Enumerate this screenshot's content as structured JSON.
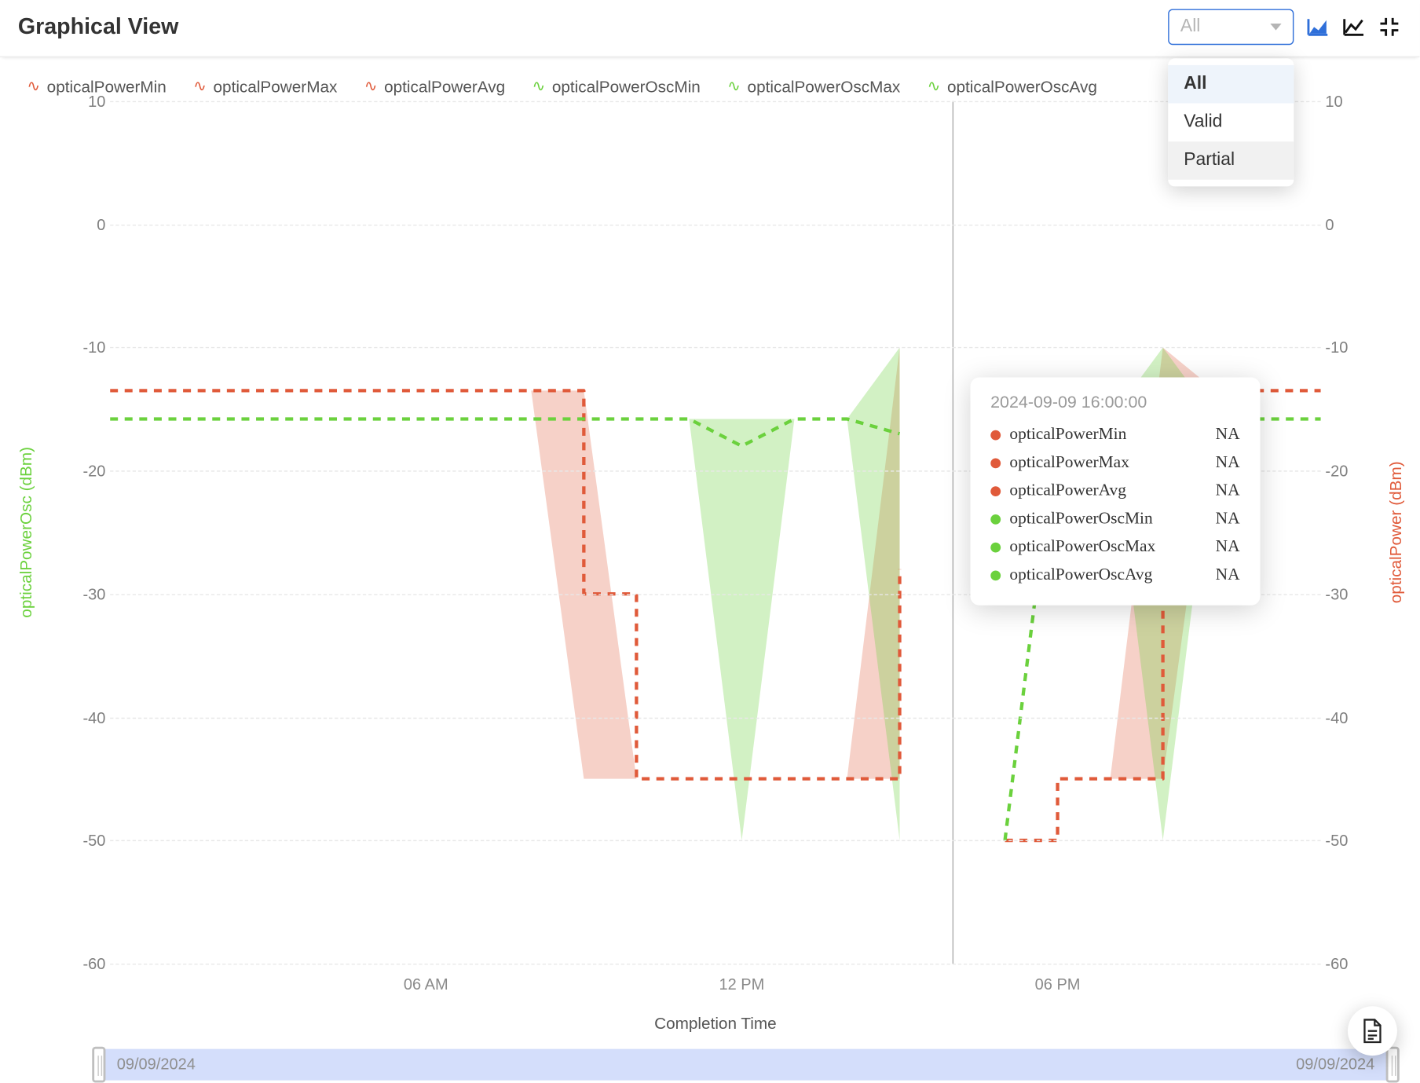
{
  "header": {
    "title": "Graphical View",
    "filter": {
      "placeholder": "All",
      "options": [
        "All",
        "Valid",
        "Partial"
      ],
      "selected": "All",
      "hovered": "Partial"
    }
  },
  "legend": [
    {
      "name": "opticalPowerMin",
      "color": "red"
    },
    {
      "name": "opticalPowerMax",
      "color": "red"
    },
    {
      "name": "opticalPowerAvg",
      "color": "red"
    },
    {
      "name": "opticalPowerOscMin",
      "color": "green"
    },
    {
      "name": "opticalPowerOscMax",
      "color": "green"
    },
    {
      "name": "opticalPowerOscAvg",
      "color": "green"
    }
  ],
  "axes": {
    "xlabel": "Completion Time",
    "xticks": [
      "06 AM",
      "12 PM",
      "06 PM"
    ],
    "yleft_label": "opticalPowerOsc (dBm)",
    "yright_label": "opticalPower (dBm)",
    "yticks_left": [
      "10",
      "0",
      "-10",
      "-20",
      "-30",
      "-40",
      "-50",
      "-60"
    ],
    "yticks_right": [
      "10",
      "0",
      "-10",
      "-20",
      "-30",
      "-40",
      "-50",
      "-60"
    ]
  },
  "tooltip": {
    "timestamp": "2024-09-09 16:00:00",
    "rows": [
      {
        "name": "opticalPowerMin",
        "color": "red",
        "value": "NA"
      },
      {
        "name": "opticalPowerMax",
        "color": "red",
        "value": "NA"
      },
      {
        "name": "opticalPowerAvg",
        "color": "red",
        "value": "NA"
      },
      {
        "name": "opticalPowerOscMin",
        "color": "green",
        "value": "NA"
      },
      {
        "name": "opticalPowerOscMax",
        "color": "green",
        "value": "NA"
      },
      {
        "name": "opticalPowerOscAvg",
        "color": "green",
        "value": "NA"
      }
    ]
  },
  "range": {
    "from": "09/09/2024",
    "to": "09/09/2024"
  },
  "colors": {
    "red": "#e05a3a",
    "green": "#6bd13d",
    "blue": "#2f6fd9"
  },
  "chart_data": {
    "type": "line",
    "x_unit": "hour_of_day",
    "x": [
      0,
      1,
      2,
      3,
      4,
      5,
      6,
      7,
      8,
      9,
      10,
      11,
      12,
      13,
      14,
      15,
      16,
      17,
      18,
      19,
      20,
      21,
      22,
      23
    ],
    "ylim": [
      -60,
      10
    ],
    "xlabel": "Completion Time",
    "ylabel_left": "opticalPowerOsc (dBm)",
    "ylabel_right": "opticalPower (dBm)",
    "series": [
      {
        "name": "opticalPowerMin",
        "axis": "right",
        "values": [
          -13.5,
          -13.5,
          -13.5,
          -13.5,
          -13.5,
          -13.5,
          -13.5,
          -13.5,
          -13.5,
          -45,
          -45,
          -45,
          -45,
          -45,
          -45,
          -45,
          null,
          -50,
          -45,
          -45,
          -45,
          -13.5,
          -13.5,
          -13.5
        ]
      },
      {
        "name": "opticalPowerMax",
        "axis": "right",
        "values": [
          -13.5,
          -13.5,
          -13.5,
          -13.5,
          -13.5,
          -13.5,
          -13.5,
          -13.5,
          -13.5,
          -13.5,
          -45,
          -45,
          -45,
          -45,
          -45,
          -10,
          null,
          -50,
          -45,
          -45,
          -10,
          -13.5,
          -13.5,
          -13.5
        ]
      },
      {
        "name": "opticalPowerAvg",
        "axis": "right",
        "values": [
          -13.5,
          -13.5,
          -13.5,
          -13.5,
          -13.5,
          -13.5,
          -13.5,
          -13.5,
          -13.5,
          -30,
          -45,
          -45,
          -45,
          -45,
          -45,
          -28,
          null,
          -50,
          -45,
          -45,
          -28,
          -13.5,
          -13.5,
          -13.5
        ]
      },
      {
        "name": "opticalPowerOscMin",
        "axis": "left",
        "values": [
          -15.8,
          -15.8,
          -15.8,
          -15.8,
          -15.8,
          -15.8,
          -15.8,
          -15.8,
          -15.8,
          -15.8,
          -15.8,
          -15.8,
          -50,
          -15.8,
          -15.8,
          -50,
          null,
          -50,
          -15.8,
          -15.8,
          -50,
          -15.8,
          -15.8,
          -15.8
        ]
      },
      {
        "name": "opticalPowerOscMax",
        "axis": "left",
        "values": [
          -15.8,
          -15.8,
          -15.8,
          -15.8,
          -15.8,
          -15.8,
          -15.8,
          -15.8,
          -15.8,
          -15.8,
          -15.8,
          -15.8,
          -15.8,
          -15.8,
          -15.8,
          -10,
          null,
          -50,
          -15.8,
          -15.8,
          -10,
          -15.8,
          -15.8,
          -15.8
        ]
      },
      {
        "name": "opticalPowerOscAvg",
        "axis": "left",
        "values": [
          -15.8,
          -15.8,
          -15.8,
          -15.8,
          -15.8,
          -15.8,
          -15.8,
          -15.8,
          -15.8,
          -15.8,
          -15.8,
          -15.8,
          -18,
          -15.8,
          -15.8,
          -17,
          null,
          -50,
          -15.8,
          -15.8,
          -17,
          -15.8,
          -15.8,
          -15.8
        ]
      }
    ],
    "cursor_hour": 16
  }
}
